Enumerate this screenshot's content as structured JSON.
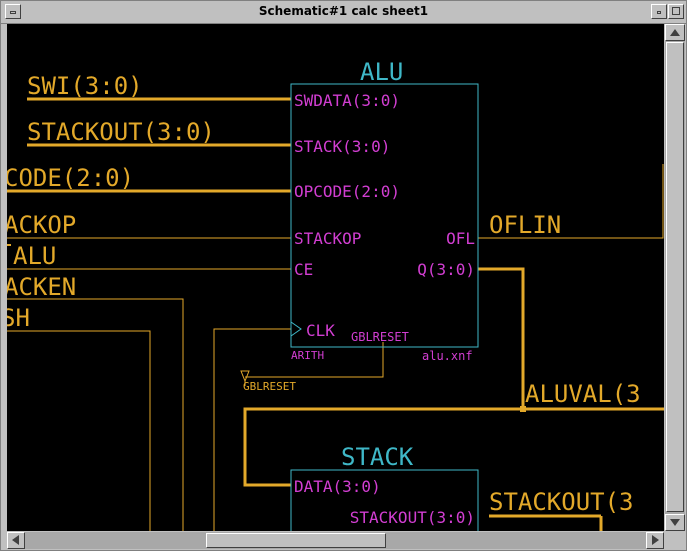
{
  "window": {
    "title": "Schematic#1 calc sheet1"
  },
  "colors": {
    "background": "#000000",
    "wire": "#e3a92a",
    "component_outline": "#3fb8c8",
    "pin_label": "#d23ed2",
    "net_label": "#e3a92a"
  },
  "schematic": {
    "alu": {
      "name": "ALU",
      "type_label": "ARITH",
      "file_label": "alu.xnf",
      "pins": {
        "swdata": "SWDATA(3:0)",
        "stack": "STACK(3:0)",
        "opcode": "OPCODE(2:0)",
        "stackop": "STACKOP",
        "ce": "CE",
        "clk": "CLK",
        "gblreset": "GBLRESET",
        "ofl": "OFL",
        "q": "Q(3:0)"
      }
    },
    "stack": {
      "name": "STACK",
      "pins": {
        "data": "DATA(3:0)",
        "stackout": "STACKOUT(3:0)"
      }
    },
    "nets": {
      "swi": "SWI(3:0)",
      "stackout_in": "STACKOUT(3:0)",
      "opcode": "CODE(2:0)",
      "stackop": "ACKOP",
      "alu_en": "ALU",
      "stacken": "ACKEN",
      "sh": "SH",
      "oflin": "OFLIN",
      "aluval": "ALUVAL(3",
      "stackout_out": "STACKOUT(3",
      "gblreset": "GBLRESET"
    }
  }
}
